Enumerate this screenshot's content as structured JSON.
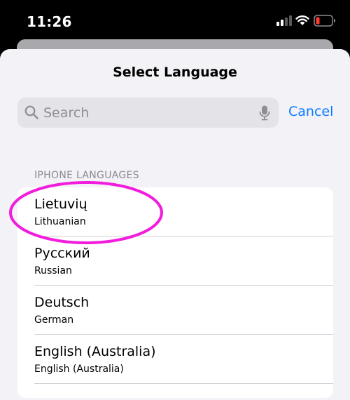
{
  "status_bar": {
    "time": "11:26",
    "icons": [
      "cellular-signal-icon",
      "wifi-icon",
      "battery-icon"
    ],
    "battery_color": "#ff3b30"
  },
  "sheet": {
    "title": "Select Language"
  },
  "search": {
    "placeholder": "Search",
    "cancel_label": "Cancel",
    "icons": [
      "search-icon",
      "microphone-icon"
    ]
  },
  "section": {
    "header": "IPHONE LANGUAGES"
  },
  "languages": [
    {
      "name": "Lietuvių",
      "english": "Lithuanian"
    },
    {
      "name": "Русский",
      "english": "Russian"
    },
    {
      "name": "Deutsch",
      "english": "German"
    },
    {
      "name": "English (Australia)",
      "english": "English (Australia)"
    }
  ],
  "colors": {
    "accent": "#0a7aff",
    "highlight_annotation": "#f21cdc",
    "sheet_background": "#f2f2f7"
  }
}
